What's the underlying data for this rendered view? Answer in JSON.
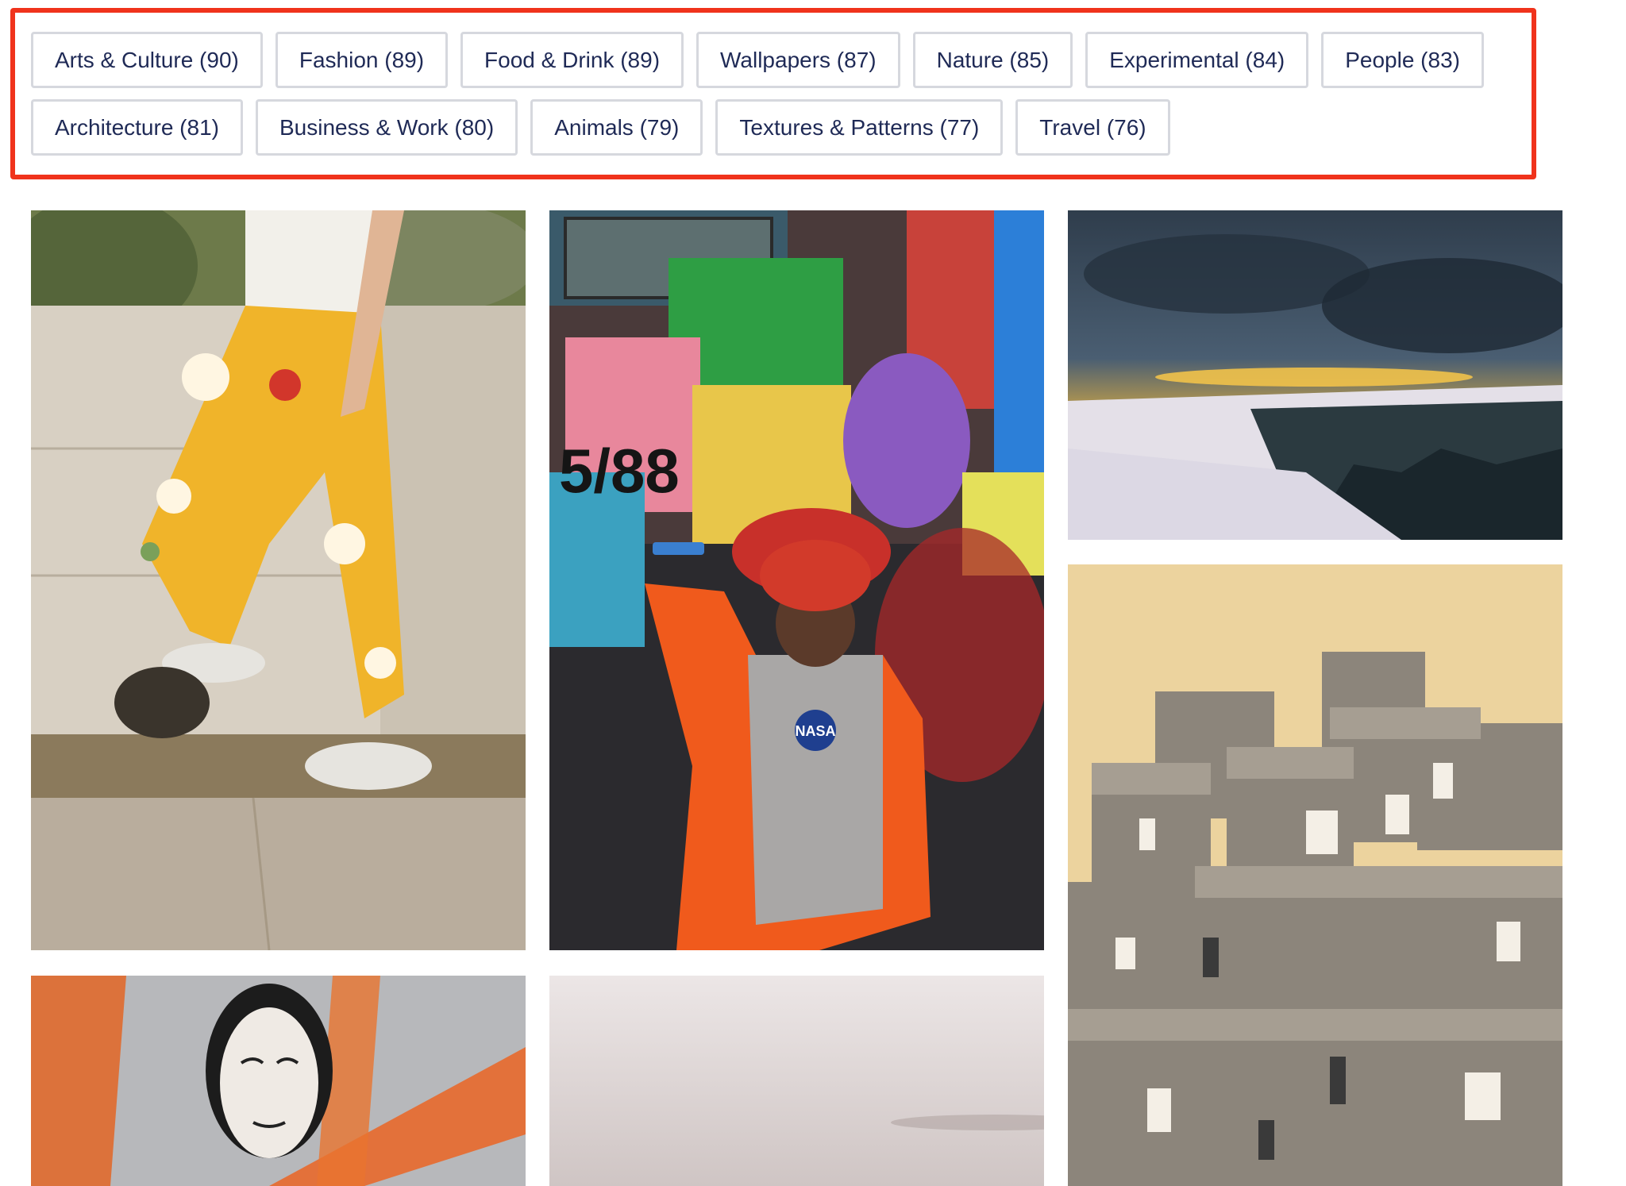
{
  "category_filters": {
    "row1": [
      {
        "label": "Arts & Culture (90)"
      },
      {
        "label": "Fashion (89)"
      },
      {
        "label": "Food & Drink (89)"
      },
      {
        "label": "Wallpapers (87)"
      },
      {
        "label": "Nature (85)"
      },
      {
        "label": "Experimental (84)"
      },
      {
        "label": "People (83)"
      }
    ],
    "row2": [
      {
        "label": "Architecture (81)"
      },
      {
        "label": "Business & Work (80)"
      },
      {
        "label": "Animals (79)"
      },
      {
        "label": "Textures & Patterns (77)"
      },
      {
        "label": "Travel (76)"
      }
    ]
  },
  "photos": {
    "graffiti_text": "5/88",
    "hoodie_logo": "NASA"
  },
  "colors": {
    "highlight_border": "#f0331c",
    "tag_text": "#1f2a56",
    "tag_border": "#d6d8de"
  }
}
